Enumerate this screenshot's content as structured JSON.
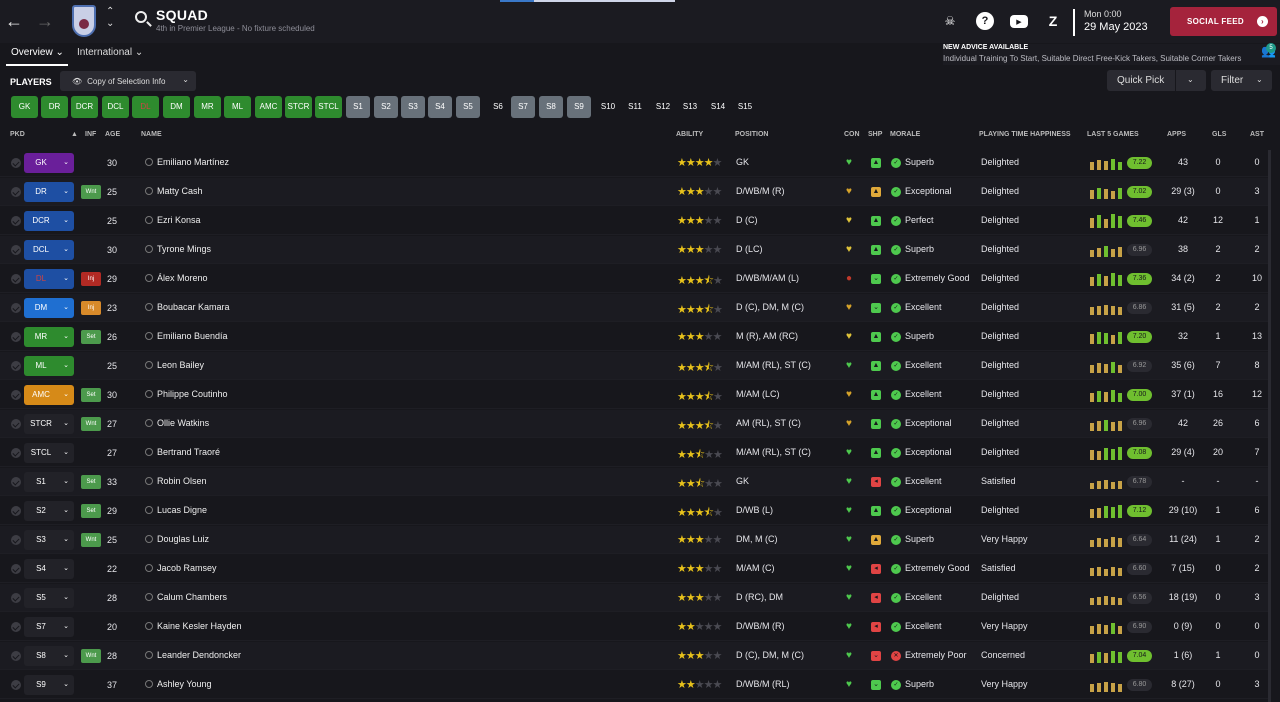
{
  "header": {
    "title": "SQUAD",
    "subtitle": "4th in Premier League - No fixture scheduled",
    "time": "Mon 0:00",
    "date": "29 May 2023",
    "social_feed": "SOCIAL FEED"
  },
  "tabs": [
    {
      "label": "Overview ⌄"
    },
    {
      "label": "International ⌄"
    }
  ],
  "advice": {
    "heading": "NEW ADVICE AVAILABLE",
    "text": "Individual Training To Start, Suitable Direct Free-Kick Takers, Suitable Corner Takers",
    "count": "5"
  },
  "toolbar": {
    "players_label": "PLAYERS",
    "copy_label": "Copy of Selection Info",
    "quick_pick": "Quick Pick",
    "filter": "Filter"
  },
  "chips": [
    "GK",
    "DR",
    "DCR",
    "DCL",
    "DL",
    "DM",
    "MR",
    "ML",
    "AMC",
    "STCR",
    "STCL",
    "S1",
    "S2",
    "S3",
    "S4",
    "S5",
    "S6",
    "S7",
    "S8",
    "S9",
    "S10",
    "S11",
    "S12",
    "S13",
    "S14",
    "S15"
  ],
  "columns": {
    "pkd": "PKD",
    "inf": "INF",
    "age": "AGE",
    "name": "NAME",
    "ability": "ABILITY",
    "position": "POSITION",
    "con": "CON",
    "shp": "SHP",
    "morale": "MORALE",
    "pth": "PLAYING TIME HAPPINESS",
    "last5": "LAST 5 GAMES",
    "apps": "APPS",
    "gls": "GLS",
    "ast": "AST"
  },
  "colors": {
    "accent": "#a5233c",
    "green": "#2e8b2e",
    "grey": "#68717a",
    "star": "#e8c21b"
  },
  "players": [
    {
      "pos": "GK",
      "inf": "",
      "age": "30",
      "name": "Emiliano Martínez",
      "stars": 4,
      "position": "GK",
      "morale": "Superb",
      "pth": "Delighted",
      "rating": "7.22",
      "apps": "43",
      "gls": "0",
      "ast": "0"
    },
    {
      "pos": "DR",
      "inf": "Wnt",
      "age": "25",
      "name": "Matty Cash",
      "stars": 3,
      "position": "D/WB/M (R)",
      "morale": "Exceptional",
      "pth": "Delighted",
      "rating": "7.02",
      "apps": "29 (3)",
      "gls": "0",
      "ast": "3"
    },
    {
      "pos": "DCR",
      "inf": "",
      "age": "25",
      "name": "Ezri Konsa",
      "stars": 3,
      "position": "D (C)",
      "morale": "Perfect",
      "pth": "Delighted",
      "rating": "7.46",
      "apps": "42",
      "gls": "12",
      "ast": "1"
    },
    {
      "pos": "DCL",
      "inf": "",
      "age": "30",
      "name": "Tyrone Mings",
      "stars": 3,
      "position": "D (LC)",
      "morale": "Superb",
      "pth": "Delighted",
      "rating": "6.96",
      "apps": "38",
      "gls": "2",
      "ast": "2"
    },
    {
      "pos": "DL",
      "inf": "Inj",
      "age": "29",
      "name": "Álex Moreno",
      "stars": 3.5,
      "position": "D/WB/M/AM (L)",
      "morale": "Extremely Good",
      "pth": "Delighted",
      "rating": "7.36",
      "apps": "34 (2)",
      "gls": "2",
      "ast": "10"
    },
    {
      "pos": "DM",
      "inf": "Inj",
      "age": "23",
      "name": "Boubacar Kamara",
      "stars": 3.5,
      "position": "D (C), DM, M (C)",
      "morale": "Excellent",
      "pth": "Delighted",
      "rating": "6.86",
      "apps": "31 (5)",
      "gls": "2",
      "ast": "2"
    },
    {
      "pos": "MR",
      "inf": "Set",
      "age": "26",
      "name": "Emiliano Buendía",
      "stars": 3,
      "position": "M (R), AM (RC)",
      "morale": "Superb",
      "pth": "Delighted",
      "rating": "7.20",
      "apps": "32",
      "gls": "1",
      "ast": "13"
    },
    {
      "pos": "ML",
      "inf": "",
      "age": "25",
      "name": "Leon Bailey",
      "stars": 3.5,
      "position": "M/AM (RL), ST (C)",
      "morale": "Excellent",
      "pth": "Delighted",
      "rating": "6.92",
      "apps": "35 (6)",
      "gls": "7",
      "ast": "8"
    },
    {
      "pos": "AMC",
      "inf": "Set",
      "age": "30",
      "name": "Philippe Coutinho",
      "stars": 3.5,
      "position": "M/AM (LC)",
      "morale": "Excellent",
      "pth": "Delighted",
      "rating": "7.00",
      "apps": "37 (1)",
      "gls": "16",
      "ast": "12"
    },
    {
      "pos": "STCR",
      "inf": "Wnt",
      "age": "27",
      "name": "Ollie Watkins",
      "stars": 3.5,
      "position": "AM (RL), ST (C)",
      "morale": "Exceptional",
      "pth": "Delighted",
      "rating": "6.96",
      "apps": "42",
      "gls": "26",
      "ast": "6"
    },
    {
      "pos": "STCL",
      "inf": "",
      "age": "27",
      "name": "Bertrand Traoré",
      "stars": 2.5,
      "position": "M/AM (RL), ST (C)",
      "morale": "Exceptional",
      "pth": "Delighted",
      "rating": "7.08",
      "apps": "29 (4)",
      "gls": "20",
      "ast": "7"
    },
    {
      "pos": "S1",
      "inf": "Set",
      "age": "33",
      "name": "Robin Olsen",
      "stars": 2.5,
      "position": "GK",
      "morale": "Excellent",
      "pth": "Satisfied",
      "rating": "6.78",
      "apps": "-",
      "gls": "-",
      "ast": "-"
    },
    {
      "pos": "S2",
      "inf": "Set",
      "age": "29",
      "name": "Lucas Digne",
      "stars": 3.5,
      "position": "D/WB (L)",
      "morale": "Exceptional",
      "pth": "Delighted",
      "rating": "7.12",
      "apps": "29 (10)",
      "gls": "1",
      "ast": "6"
    },
    {
      "pos": "S3",
      "inf": "Wnt",
      "age": "25",
      "name": "Douglas Luiz",
      "stars": 3,
      "position": "DM, M (C)",
      "morale": "Superb",
      "pth": "Very Happy",
      "rating": "6.64",
      "apps": "11 (24)",
      "gls": "1",
      "ast": "2"
    },
    {
      "pos": "S4",
      "inf": "",
      "age": "22",
      "name": "Jacob Ramsey",
      "stars": 3,
      "position": "M/AM (C)",
      "morale": "Extremely Good",
      "pth": "Satisfied",
      "rating": "6.60",
      "apps": "7 (15)",
      "gls": "0",
      "ast": "2"
    },
    {
      "pos": "S5",
      "inf": "",
      "age": "28",
      "name": "Calum Chambers",
      "stars": 3,
      "position": "D (RC), DM",
      "morale": "Excellent",
      "pth": "Delighted",
      "rating": "6.56",
      "apps": "18 (19)",
      "gls": "0",
      "ast": "3"
    },
    {
      "pos": "S7",
      "inf": "",
      "age": "20",
      "name": "Kaine Kesler Hayden",
      "stars": 2,
      "position": "D/WB/M (R)",
      "morale": "Excellent",
      "pth": "Very Happy",
      "rating": "6.90",
      "apps": "0 (9)",
      "gls": "0",
      "ast": "0"
    },
    {
      "pos": "S8",
      "inf": "Wnt",
      "age": "28",
      "name": "Leander Dendoncker",
      "stars": 3,
      "position": "D (C), DM, M (C)",
      "morale": "Extremely Poor",
      "pth": "Concerned",
      "rating": "7.04",
      "apps": "1 (6)",
      "gls": "1",
      "ast": "0"
    },
    {
      "pos": "S9",
      "inf": "",
      "age": "37",
      "name": "Ashley Young",
      "stars": 2,
      "position": "D/WB/M (RL)",
      "morale": "Superb",
      "pth": "Very Happy",
      "rating": "6.80",
      "apps": "8 (27)",
      "gls": "0",
      "ast": "3"
    }
  ]
}
